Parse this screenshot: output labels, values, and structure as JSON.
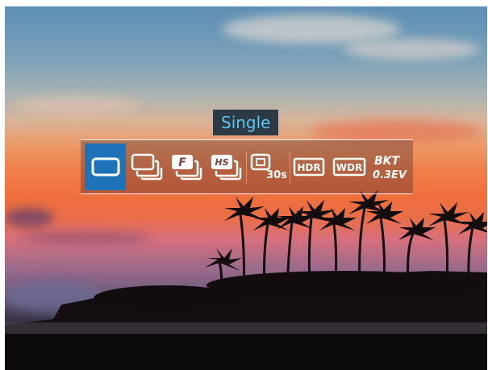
{
  "hud": {
    "selected_mode_label": "Single"
  },
  "modes": [
    {
      "id": "single",
      "icon": "single-shot-icon",
      "selected": true
    },
    {
      "id": "continuous",
      "icon": "continuous-shot-icon",
      "selected": false
    },
    {
      "id": "continuous-fast",
      "icon": "continuous-fast-icon",
      "label": "F",
      "selected": false
    },
    {
      "id": "continuous-high-speed",
      "icon": "continuous-high-speed-icon",
      "label": "HS",
      "selected": false
    },
    {
      "id": "self-timer",
      "icon": "self-timer-icon",
      "label": "30s",
      "selected": false
    },
    {
      "id": "hdr",
      "icon": "hdr-icon",
      "label": "HDR",
      "selected": false
    },
    {
      "id": "wdr",
      "icon": "wdr-icon",
      "label": "WDR",
      "selected": false
    },
    {
      "id": "bracketing",
      "icon": "bracketing-icon",
      "label_top": "BKT",
      "label_bottom": "0.3EV",
      "selected": false
    }
  ],
  "colors": {
    "selection": "#1e73b8",
    "title_text": "#5ec6f2",
    "title_bg": "#2b3a44"
  }
}
